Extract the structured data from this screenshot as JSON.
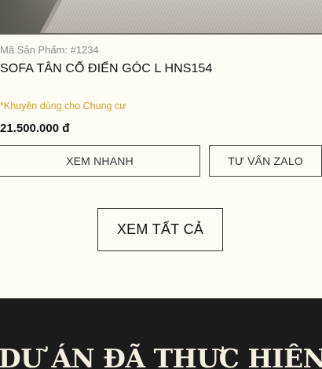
{
  "product": {
    "sku_text": "Mã Sản Phẩm: #1234",
    "name": "SOFA TÂN CỔ ĐIỂN GÓC L HNS154",
    "recommendation": "*Khuyên dùng cho Chung cư",
    "price": "21.500.000 đ",
    "quick_view_label": "XEM NHANH",
    "zalo_label": "TƯ VẤN ZALO"
  },
  "view_all_label": "XEM TẤT CẢ",
  "projects_section": {
    "title": "DỰ ÁN ĐÃ THỰC HIỆN"
  },
  "colors": {
    "background": "#fefcf5",
    "accent_gold": "#c9a227",
    "dark_section": "#1b1b1b"
  }
}
